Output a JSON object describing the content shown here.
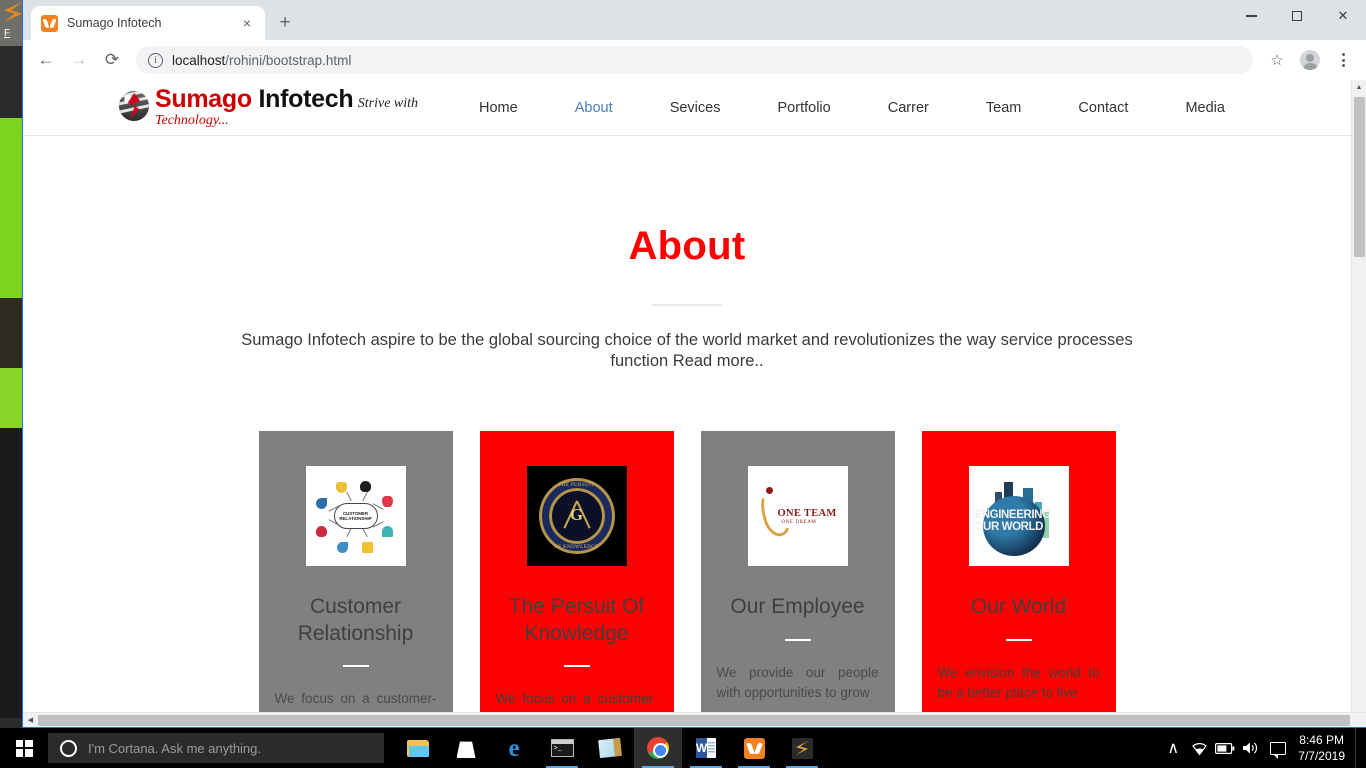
{
  "browser": {
    "tab": {
      "title": "Sumago Infotech",
      "favicon": "xampp-favicon",
      "close": "×"
    },
    "newtab_label": "+",
    "window_controls": {
      "minimize": "–",
      "maximize": "☐",
      "close": "✕"
    },
    "toolbar": {
      "back": "←",
      "forward": "→",
      "reload": "⟳",
      "info": "i",
      "url_host": "localhost",
      "url_path": "/rohini/bootstrap.html",
      "bookmark": "☆",
      "profile": "profile-avatar",
      "menu": "kebab-menu"
    }
  },
  "page": {
    "logo": {
      "name_first": "Sumago",
      "name_second": "Infotech",
      "tagline_first": "Strive with ",
      "tagline_second": "Technology..."
    },
    "nav": [
      {
        "label": "Home",
        "active": false
      },
      {
        "label": "About",
        "active": true
      },
      {
        "label": "Sevices",
        "active": false
      },
      {
        "label": "Portfolio",
        "active": false
      },
      {
        "label": "Carrer",
        "active": false
      },
      {
        "label": "Team",
        "active": false
      },
      {
        "label": "Contact",
        "active": false
      },
      {
        "label": "Media",
        "active": false
      }
    ],
    "about": {
      "title": "About",
      "lead": "Sumago Infotech aspire to be the global sourcing choice of the world market and revolutionizes the way service processes function Read more.."
    },
    "cards": [
      {
        "title": "Customer Relationship",
        "body": "We focus on a customer-first approach and value",
        "bg": "#808080",
        "theme": "grey",
        "image": "customer-relationship-mindmap",
        "image_caption": "CUSTOMER RELATIONSHIP"
      },
      {
        "title": "The Persuit Of Knowledge",
        "body": "We focus on a customer-first approach and value",
        "bg": "#ff0000",
        "theme": "red",
        "image": "pursuit-of-knowledge-emblem",
        "image_caption_top": "THE PURSUIT",
        "image_caption_bottom": "OF KNOWLEDGE",
        "image_letter": "G"
      },
      {
        "title": "Our Employee",
        "body": "We provide our people with opportunities to grow",
        "bg": "#808080",
        "theme": "grey",
        "image": "one-team-one-dream-logo",
        "image_caption": "ONE TEAM",
        "image_caption_sub": "ONE DREAM"
      },
      {
        "title": "Our World",
        "body": "We envision the world to be a better place to live",
        "bg": "#ff0000",
        "theme": "red",
        "image": "engineering-our-world-globe",
        "image_caption": "ENGINEERING",
        "image_caption_sub": "OUR WORLD"
      }
    ],
    "scrollbars": {
      "v_up": "▲",
      "h_left": "◀"
    }
  },
  "taskbar": {
    "start": "windows-start",
    "cortana_placeholder": "I'm Cortana. Ask me anything.",
    "apps": [
      {
        "name": "file-explorer",
        "active": false,
        "running": false
      },
      {
        "name": "microsoft-store",
        "active": false,
        "running": false
      },
      {
        "name": "microsoft-edge",
        "active": false,
        "running": false
      },
      {
        "name": "command-prompt",
        "active": false,
        "running": true
      },
      {
        "name": "sticky-notes",
        "active": false,
        "running": false
      },
      {
        "name": "google-chrome",
        "active": true,
        "running": true
      },
      {
        "name": "microsoft-word",
        "active": false,
        "running": true
      },
      {
        "name": "xampp-control-panel",
        "active": false,
        "running": true
      },
      {
        "name": "sublime-text",
        "active": false,
        "running": true
      }
    ],
    "tray": {
      "expand": "∧",
      "wifi": "wifi-icon",
      "battery": "battery-icon",
      "volume": "volume-icon",
      "action_center": "action-center-icon"
    },
    "clock_time": "8:46 PM",
    "clock_date": "7/7/2019"
  },
  "colors": {
    "accent_red": "#ff0000",
    "logo_red": "#cc0000",
    "card_grey": "#808080",
    "nav_active": "#4a7ebb",
    "chrome_blue": "#1a73e8"
  }
}
